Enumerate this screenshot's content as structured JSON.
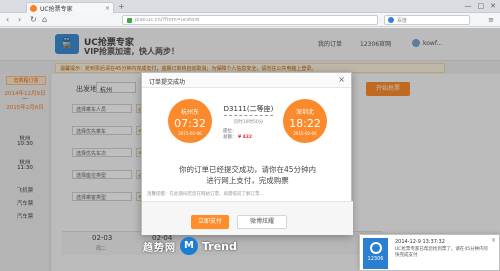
{
  "browser": {
    "tab_title": "UC抢票专家",
    "address": "piao.uc.cn/?from=ucstore",
    "search_placeholder": "百度",
    "window_controls": [
      "—",
      "□",
      "✕"
    ]
  },
  "site": {
    "brand_name": "UC抢票专家",
    "slogan": "VIP抢票加速，快人两步！",
    "nav": [
      "我的订单",
      "12306官网",
      "kowf..."
    ]
  },
  "notice": "温馨提示：抢到票后请在45分钟内完成支付，逾期订单将自动取消；为保障个人信息安全，请勿在公共电脑上登录。",
  "left_panel": {
    "ctrip_btn": "去携程订票",
    "date_from": "2014年12月9日",
    "date_to": "2015年2月6日",
    "city1": "杭州",
    "time1": "10:30",
    "city2": "杭州",
    "time2": "11:30",
    "extra1": "飞机票",
    "extra2": "汽车票",
    "extra3": "汽车票"
  },
  "search_form": {
    "from_label": "出发地",
    "from_value": "杭州",
    "filters": [
      "选择乘车人员",
      "选择优先乘车",
      "选择优先车次",
      "选择座位类型",
      "选择乘客类型"
    ],
    "filter_tags": [
      "必填",
      "可选",
      "可选",
      "必填",
      "可选"
    ],
    "remote_btn": "开始抢票"
  },
  "dates": [
    {
      "date": "02-03",
      "day": "周二"
    },
    {
      "date": "02-04",
      "day": "周三"
    }
  ],
  "modal": {
    "title": "订单提交成功",
    "close": "×",
    "from_station": "杭州东",
    "from_time": "07:32",
    "from_date": "2015-02-06",
    "to_station": "深圳北",
    "to_time": "18:22",
    "to_date": "2015-02-06",
    "train_no": "D3111(二等座)",
    "duration": "历时10时50分",
    "seat_label": "座位：",
    "seat_value": "",
    "price_label": "总额：",
    "price_value": "¥ 432",
    "message_line1": "你的订单已经提交成功，请你在45分钟内",
    "message_line2": "进行网上支付，完成购票",
    "hint": "温馨提醒：在此期间若您在网站订票，再需提前了解订票…",
    "pay_btn": "立即支付",
    "weibo_btn": "微博炫耀"
  },
  "watermark": {
    "text": "趋势网",
    "logo": "M",
    "trend": "Trend"
  },
  "toast": {
    "icon_label": "12306",
    "time": "2014-12-9 13:37:32",
    "text": "UC抢票专家已帮您抢到票了，请在45分钟内尽快完成支付",
    "close": "×"
  },
  "colors": {
    "accent": "#ff8d2c",
    "primary_blue": "#2a7fd0",
    "price_red": "#e33333"
  }
}
